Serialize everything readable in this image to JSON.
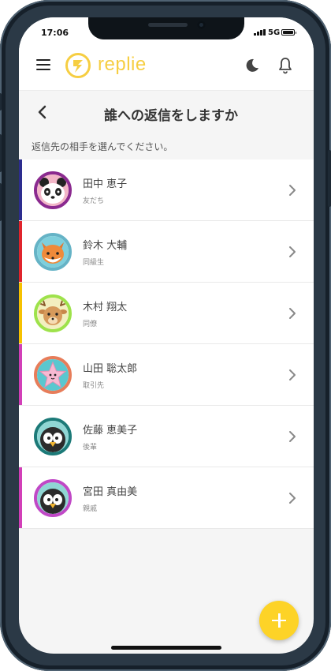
{
  "status_bar": {
    "time": "17:06",
    "network": "5G"
  },
  "app_bar": {
    "brand": "replie",
    "brand_color": "#f6ce42",
    "icons": [
      "menu-icon",
      "moon-icon",
      "bell-icon"
    ]
  },
  "page": {
    "title": "誰への返信をしますか",
    "subtitle": "返信先の相手を選んでください。"
  },
  "contacts": [
    {
      "name": "田中 恵子",
      "relation": "友だち",
      "bar_color": "#2d2d8f",
      "avatar_animal": "panda",
      "avatar_ring": "#8b2a8f"
    },
    {
      "name": "鈴木 大輔",
      "relation": "同級生",
      "bar_color": "#e0242c",
      "avatar_animal": "fox",
      "avatar_ring": "#65b3c6"
    },
    {
      "name": "木村 翔太",
      "relation": "同僚",
      "bar_color": "#f6c100",
      "avatar_animal": "deer",
      "avatar_ring": "#9ee24b"
    },
    {
      "name": "山田 聡太郎",
      "relation": "取引先",
      "bar_color": "#d23fb8",
      "avatar_animal": "star",
      "avatar_ring": "#e77d5a"
    },
    {
      "name": "佐藤 恵美子",
      "relation": "後輩",
      "bar_color": "#ffffff",
      "avatar_animal": "penguin",
      "avatar_ring": "#1c7a78"
    },
    {
      "name": "宮田 真由美",
      "relation": "親戚",
      "bar_color": "#d23fb8",
      "avatar_animal": "penguin",
      "avatar_ring": "#c048c6"
    }
  ],
  "fab": {
    "icon": "plus-icon",
    "color": "#fdd327"
  }
}
